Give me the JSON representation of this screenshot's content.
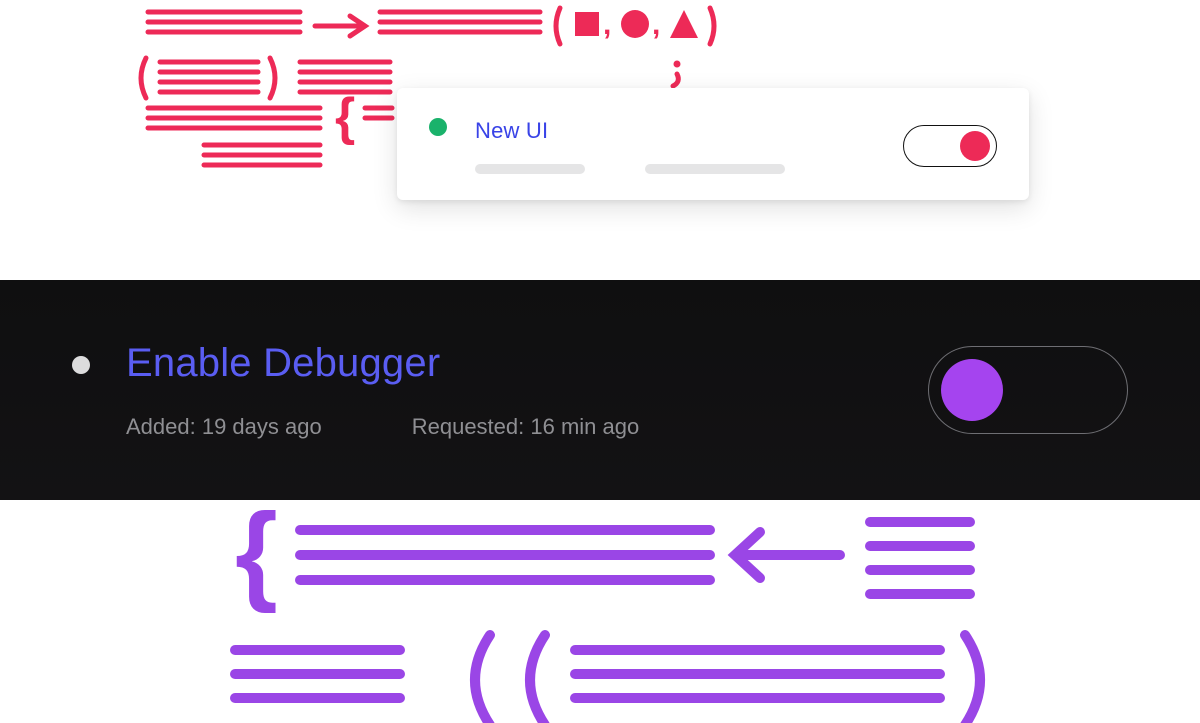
{
  "colors": {
    "accent_red": "#ed2a57",
    "accent_green": "#1ab26b",
    "accent_blue": "#3943e7",
    "accent_purple": "#a544ef",
    "dark_panel_bg": "#0f0f10",
    "muted_text": "#8f8f93"
  },
  "top_card": {
    "status": "active",
    "title": "New UI",
    "toggle_state": "on"
  },
  "dark_card": {
    "status": "inactive",
    "title": "Enable Debugger",
    "added_label": "Added: 19 days ago",
    "requested_label": "Requested: 16 min ago",
    "toggle_state": "off"
  }
}
